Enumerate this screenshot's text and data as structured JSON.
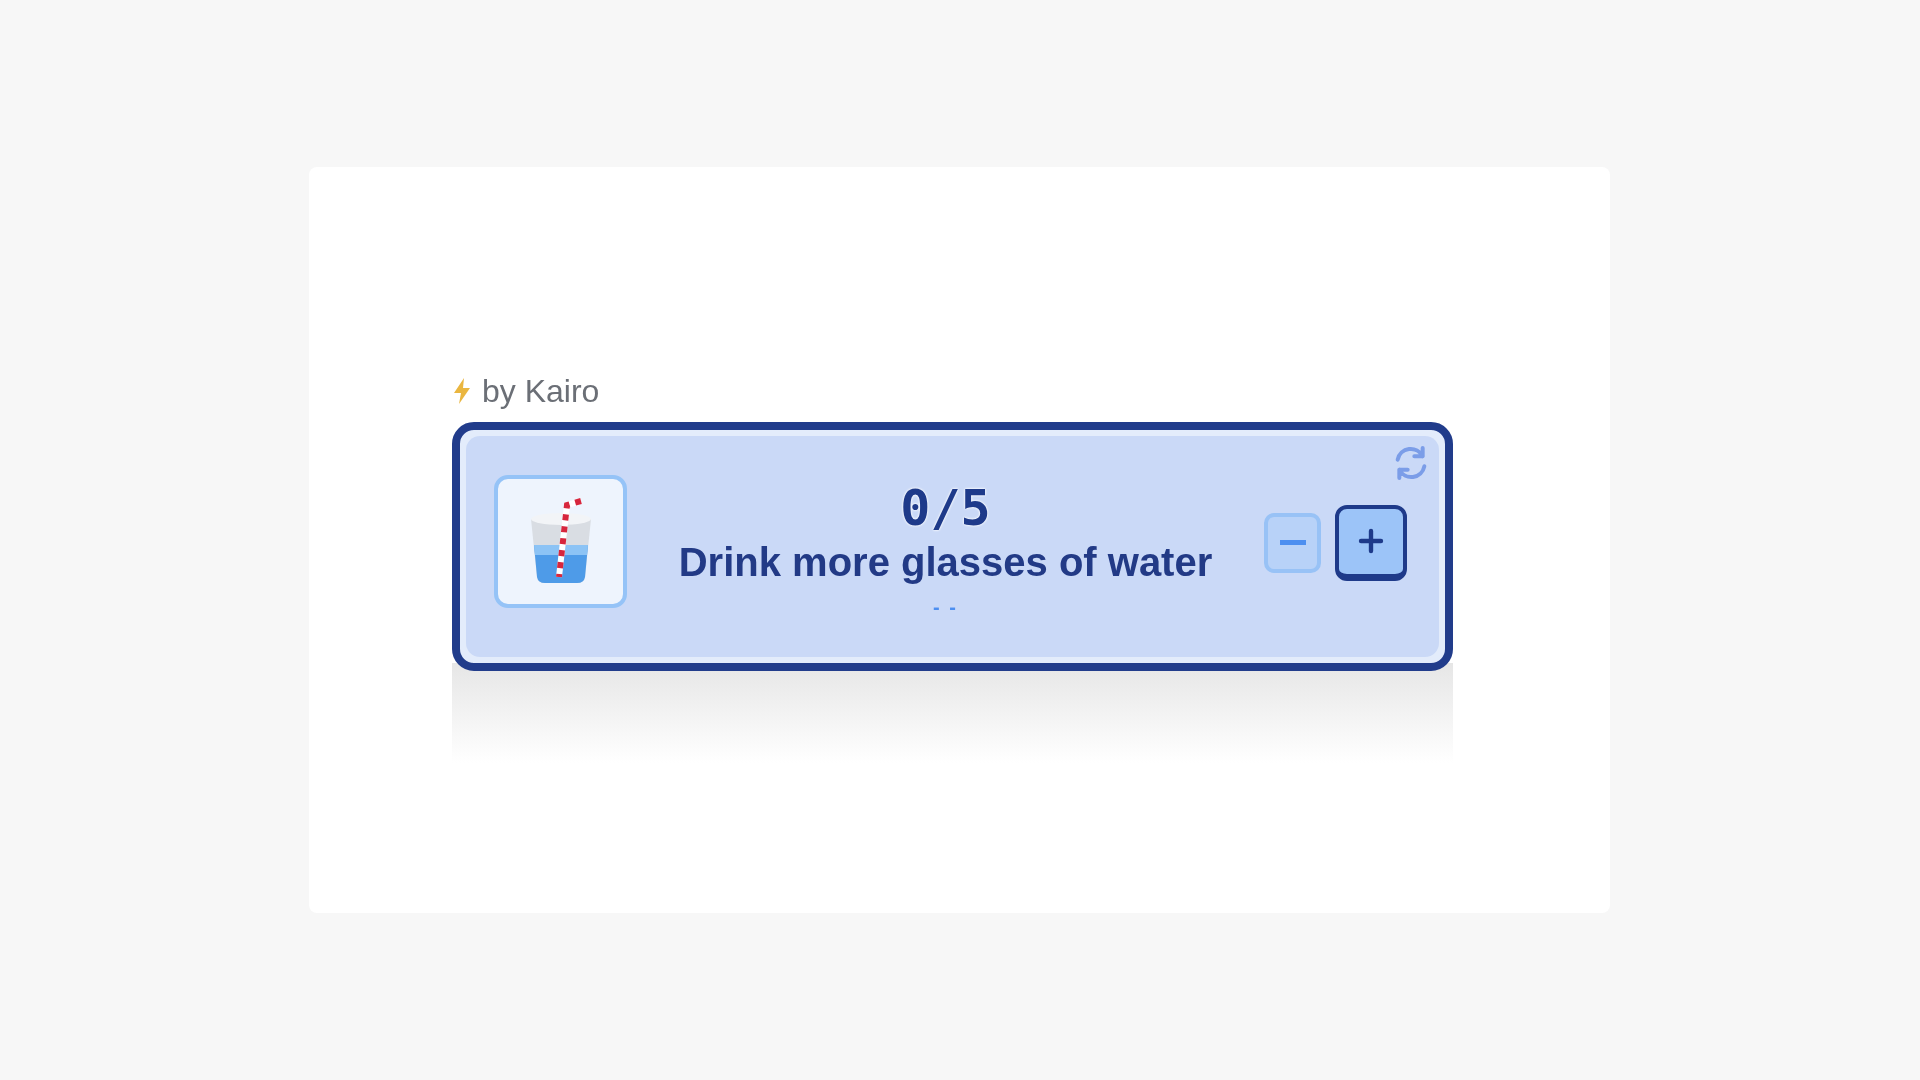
{
  "author": "by Kairo",
  "tracker": {
    "count": "0/5",
    "title": "Drink more glasses of water",
    "status": "- -"
  }
}
